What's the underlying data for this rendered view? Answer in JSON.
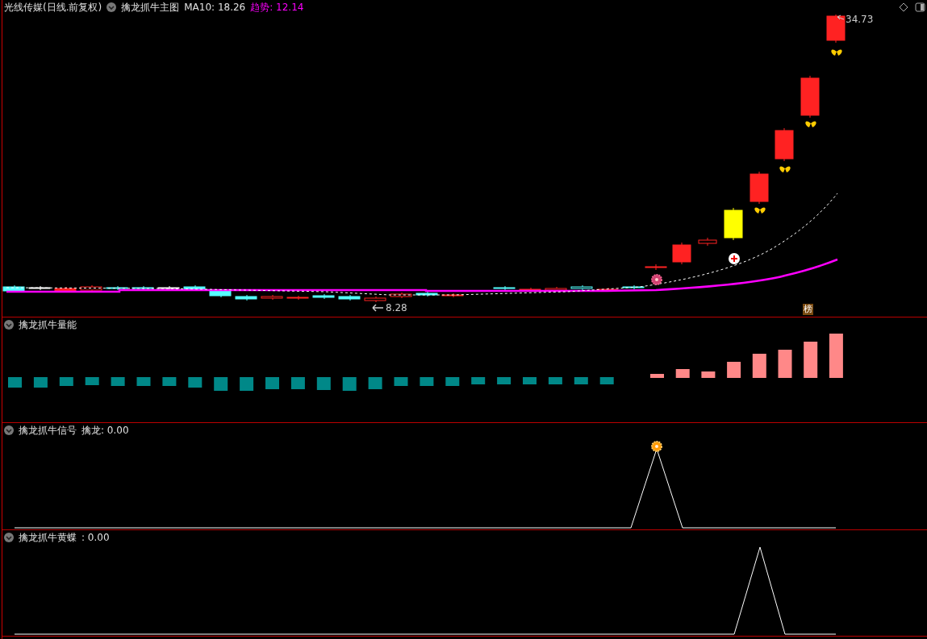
{
  "header": {
    "stock": "光线传媒(日线.前复权)",
    "indicator": "擒龙抓牛主图",
    "ma10": "MA10: 18.26",
    "trend": "趋势: 12.14"
  },
  "main_chart": {
    "high_label": "34.73",
    "low_label": "8.28",
    "badge": "榜"
  },
  "panels": [
    {
      "kind": "volume",
      "title": "擒龙抓牛量能"
    },
    {
      "kind": "signal",
      "title": "擒龙抓牛信号",
      "value": "擒龙: 0.00"
    },
    {
      "kind": "butterfly",
      "title": "擒龙抓牛黄蝶",
      "value": ": 0.00"
    }
  ]
}
